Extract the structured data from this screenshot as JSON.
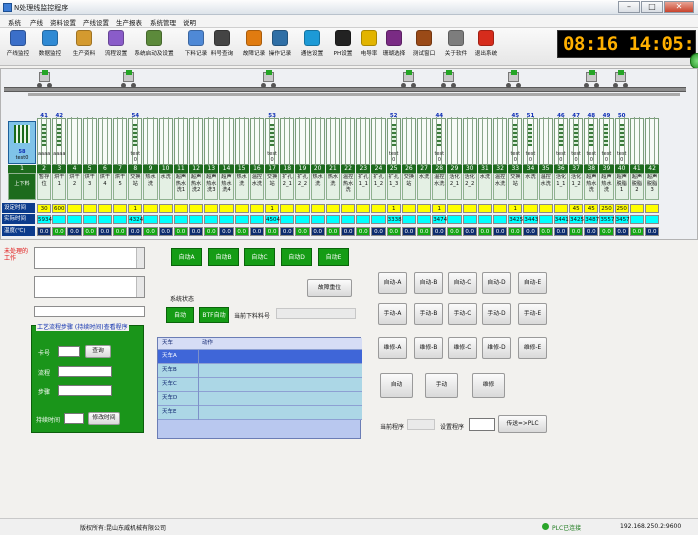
{
  "window": {
    "title": "N处理线监控程序"
  },
  "menu": [
    "系统",
    "产线",
    "资料设置",
    "产线设置",
    "生产报表",
    "系统管理",
    "说明"
  ],
  "toolbar": [
    {
      "label": "产线监控",
      "icon": "monitor-icon",
      "color": "#3b6fc9"
    },
    {
      "label": "数据监控",
      "icon": "database-icon",
      "color": "#2f8ad4"
    },
    {
      "label": "生产资料",
      "icon": "documents-icon",
      "color": "#d49a2f"
    },
    {
      "label": "流程设置",
      "icon": "flow-icon",
      "color": "#8a5cc9"
    },
    {
      "label": "系统启动及设置",
      "icon": "system-setup-icon",
      "color": "#5c8a3b"
    },
    {
      "label": "下料记录",
      "icon": "search-icon",
      "color": "#4f89d6"
    },
    {
      "label": "料号查询",
      "icon": "barcode-icon",
      "color": "#444444"
    },
    {
      "label": "故障记录",
      "icon": "warning-icon",
      "color": "#e07b10"
    },
    {
      "label": "操作记录",
      "icon": "clock-icon",
      "color": "#2f6fa6"
    },
    {
      "label": "通信设置",
      "icon": "skype-icon",
      "color": "#1d9ad6"
    },
    {
      "label": "PH设置",
      "icon": "ph-icon",
      "color": "#222222"
    },
    {
      "label": "电导率",
      "icon": "lightning-icon",
      "color": "#e2b400"
    },
    {
      "label": "珊瑚选择",
      "icon": "gallery-icon",
      "color": "#7a2b84"
    },
    {
      "label": "测试窗口",
      "icon": "window-icon",
      "color": "#9a4a17"
    },
    {
      "label": "关于软件",
      "icon": "building-icon",
      "color": "#7d7d7d"
    },
    {
      "label": "退出系统",
      "icon": "exit-icon",
      "color": "#d62c1c"
    }
  ],
  "clock": {
    "text": "08:16 14:05:51"
  },
  "stations": [
    {
      "num": "1",
      "name": "上下料"
    },
    {
      "num": "2",
      "name": "暂存位"
    },
    {
      "num": "3",
      "name": "烘干1"
    },
    {
      "num": "4",
      "name": "烘干2"
    },
    {
      "num": "5",
      "name": "烘干3"
    },
    {
      "num": "6",
      "name": "烘干4"
    },
    {
      "num": "7",
      "name": "烘干5"
    },
    {
      "num": "8",
      "name": "交换站"
    },
    {
      "num": "9",
      "name": "热水洗"
    },
    {
      "num": "10",
      "name": "水洗"
    },
    {
      "num": "11",
      "name": "超声热水洗1"
    },
    {
      "num": "12",
      "name": "超声热水洗2"
    },
    {
      "num": "13",
      "name": "超声热水洗3"
    },
    {
      "num": "14",
      "name": "超声热水洗4"
    },
    {
      "num": "15",
      "name": "热水洗"
    },
    {
      "num": "16",
      "name": "温控水洗"
    },
    {
      "num": "17",
      "name": "交换站"
    },
    {
      "num": "18",
      "name": "扩孔2_1"
    },
    {
      "num": "19",
      "name": "扩孔2_2"
    },
    {
      "num": "20",
      "name": "热水洗"
    },
    {
      "num": "21",
      "name": "热水洗"
    },
    {
      "num": "22",
      "name": "温控热水洗"
    },
    {
      "num": "23",
      "name": "扩孔1_1"
    },
    {
      "num": "24",
      "name": "扩孔1_2"
    },
    {
      "num": "25",
      "name": "扩孔1_3"
    },
    {
      "num": "26",
      "name": "交换站"
    },
    {
      "num": "27",
      "name": "水洗"
    },
    {
      "num": "28",
      "name": "温控水洗"
    },
    {
      "num": "29",
      "name": "活化2_1"
    },
    {
      "num": "30",
      "name": "活化2_2"
    },
    {
      "num": "31",
      "name": "水洗"
    },
    {
      "num": "32",
      "name": "温控水洗"
    },
    {
      "num": "33",
      "name": "交换站"
    },
    {
      "num": "34",
      "name": "水洗"
    },
    {
      "num": "35",
      "name": "温控水洗"
    },
    {
      "num": "36",
      "name": "活化1_1"
    },
    {
      "num": "37",
      "name": "活化1_2"
    },
    {
      "num": "38",
      "name": "超声热水洗"
    },
    {
      "num": "39",
      "name": "超声热水洗"
    },
    {
      "num": "40",
      "name": "超声脱脂1"
    },
    {
      "num": "41",
      "name": "超声脱脂2"
    },
    {
      "num": "42",
      "name": "超声脱脂3"
    }
  ],
  "hangers": [
    {
      "num": "41",
      "text": "aaaa"
    },
    {
      "num": "42",
      "text": "aaaa"
    },
    {
      "num": "54",
      "text": "test 0"
    },
    {
      "num": "53",
      "text": "test 0"
    },
    {
      "num": "52",
      "text": "test 0"
    },
    {
      "num": "44",
      "text": "test 0"
    },
    {
      "num": "45",
      "text": "test 0"
    },
    {
      "num": "51",
      "text": "test 0"
    },
    {
      "num": "46",
      "text": "test 0"
    },
    {
      "num": "47",
      "text": "test 0"
    },
    {
      "num": "48",
      "text": "test 0"
    },
    {
      "num": "49",
      "text": "test 0"
    },
    {
      "num": "50",
      "text": "test 0"
    }
  ],
  "loadbox": {
    "num": "58",
    "text": "test0"
  },
  "rows": {
    "set_time": {
      "label": "设定时间",
      "values": {
        "1": "30",
        "2": "600",
        "7": "1",
        "16": "1",
        "24": "1",
        "27": "1",
        "32": "1",
        "36": "45",
        "37": "45",
        "38": "250",
        "39": "250"
      }
    },
    "actual_time": {
      "label": "实际时间",
      "values": {
        "0": "58",
        "1": "5934",
        "7": "4324",
        "16": "4504",
        "24": "3338",
        "27": "3474",
        "32": "3425",
        "33": "3443",
        "35": "3441",
        "36": "3425",
        "37": "3487",
        "38": "3557",
        "39": "3457"
      }
    },
    "temperature": {
      "label": "温度(℃)",
      "value": "0.0"
    }
  },
  "left": {
    "alarm_text": "未处理的工作",
    "recipe_caption": "工艺流程步骤 (持续时间)查看程序",
    "card_label": "卡号",
    "query": "查询",
    "flow_label": "流程",
    "step_label": "步骤",
    "hold_label": "持续时间",
    "modify_time": "修改时间"
  },
  "center": {
    "auto_buttons": [
      "自动A",
      "自动B",
      "自动C",
      "自动D",
      "自动E"
    ],
    "fault_reset": "故障重位",
    "system_status": "系统状态",
    "auto_status": "自动",
    "btf_auto": "BTF自动",
    "current_label": "当前下料料号",
    "grid_header": [
      "天车",
      "动作"
    ],
    "grid_rows": [
      "天车A",
      "天车B",
      "天车C",
      "天车D",
      "天车E"
    ]
  },
  "right": {
    "auto": [
      "自动-A",
      "自动-B",
      "自动-C",
      "自动-D",
      "自动-E"
    ],
    "manual": [
      "手动-A",
      "手动-B",
      "手动-C",
      "手动-D",
      "手动-E"
    ],
    "maint": [
      "维修-A",
      "维修-B",
      "维修-C",
      "维修-D",
      "维修-E"
    ],
    "mode_auto": "自动",
    "mode_manual": "手动",
    "mode_maint": "维修",
    "current_program": "当前程序",
    "set_program": "设置程序",
    "send_plc": "传送=>PLC"
  },
  "status": {
    "copyright": "版权所有:昆山东威机械有限公司",
    "plc": "PLC已连接",
    "ip": "192.168.250.2:9600"
  },
  "colors": {
    "yellow": "#ffff00",
    "cyan": "#00ffff",
    "green": "#14a614",
    "navy": "#0c3b8c"
  }
}
